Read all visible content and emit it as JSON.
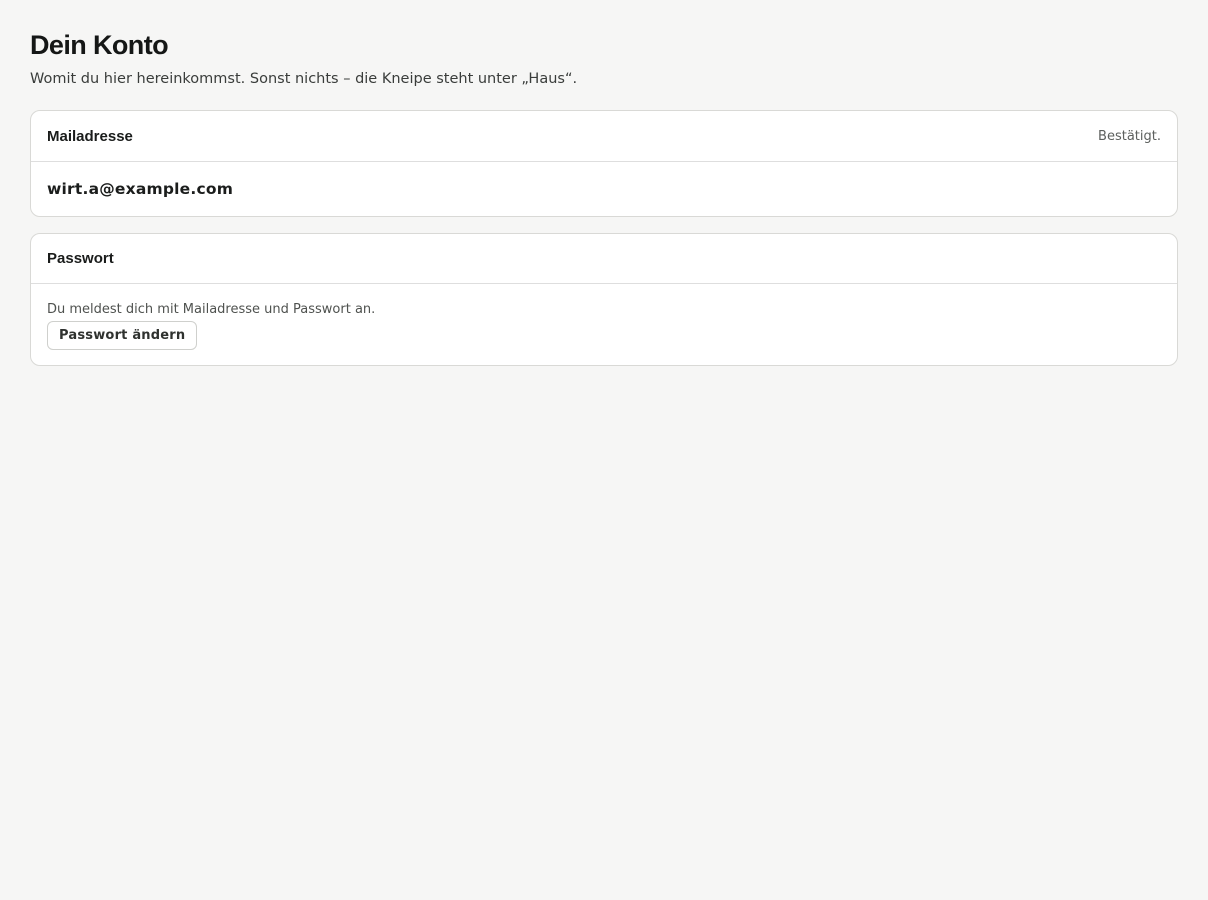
{
  "header": {
    "title": "Dein Konto",
    "subtitle": "Womit du hier hereinkommst. Sonst nichts – die Kneipe steht unter „Haus“."
  },
  "email_card": {
    "title": "Mailadresse",
    "status": "Bestätigt.",
    "value": "wirt.a@example.com"
  },
  "password_card": {
    "title": "Passwort",
    "hint": "Du meldest dich mit Mailadresse und Passwort an.",
    "button_label": "Passwort ändern"
  },
  "colors": {
    "background": "#f6f6f5",
    "card_background": "#ffffff",
    "border": "#d9d9d6",
    "text_primary": "#1b1d1c",
    "text_muted": "#5d605e"
  }
}
